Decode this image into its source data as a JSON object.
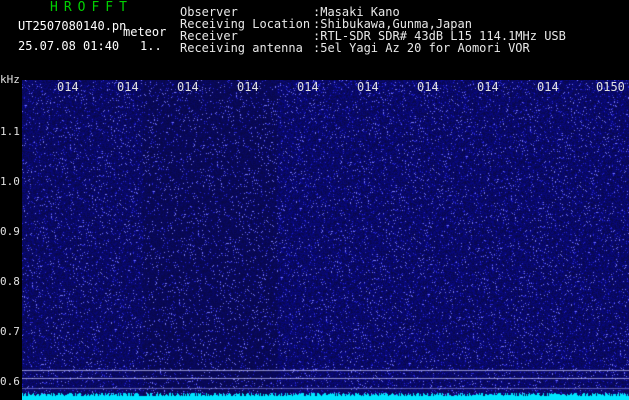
{
  "app": {
    "title": "HROFFT",
    "filename": "UT2507080140.pn",
    "mode": "meteor",
    "datetime": "25.07.08 01:40",
    "index": "1.."
  },
  "meta": {
    "labels": [
      "Observer",
      "Receiving Location",
      "Receiver",
      "Receiving antenna"
    ],
    "values": [
      ":Masaki Kano",
      ":Shibukawa,Gunma,Japan",
      ":RTL-SDR SDR# 43dB L15 114.1MHz USB",
      ":5el Yagi Az 20 for Aomori VOR"
    ]
  },
  "axis": {
    "unit": "kHz",
    "yticks": [
      "1.1",
      "1.0",
      "0.9",
      "0.8",
      "0.7",
      "0.6"
    ],
    "xticks": [
      "014",
      "014",
      "014",
      "014",
      "014",
      "014",
      "014",
      "014",
      "014",
      "0150"
    ]
  },
  "colors": {
    "bg": "#000000",
    "spectrum": "#13138c",
    "noise": "#3a3aff",
    "baseline": "#00e5ff",
    "title": "#00d000"
  }
}
